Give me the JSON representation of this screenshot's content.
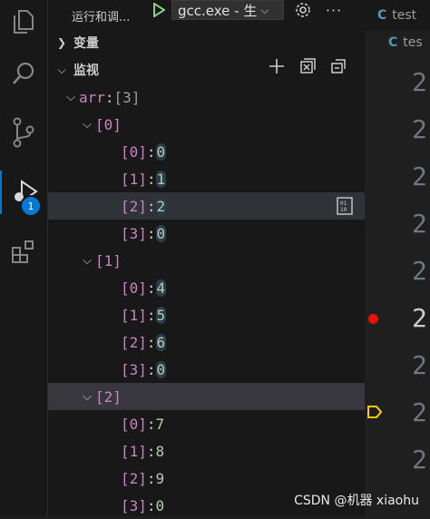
{
  "activity_bar": {
    "icons": [
      "files-icon",
      "search-icon",
      "source-control-icon",
      "run-debug-icon",
      "extensions-icon"
    ],
    "debug_badge": "1"
  },
  "sidebar": {
    "title": "运行和调...",
    "run_config": "gcc.exe - 生",
    "sections": {
      "variables": "变量",
      "watch": "监视"
    },
    "watch_rows": [
      {
        "indent": 0,
        "chev": "v",
        "name": "arr",
        "value": "[3]",
        "kind": "root"
      },
      {
        "indent": 1,
        "chev": "v",
        "name": "[0]",
        "value": "",
        "kind": "group"
      },
      {
        "indent": 2,
        "chev": "",
        "name": "[0]",
        "value": "0",
        "kind": "leaf"
      },
      {
        "indent": 2,
        "chev": "",
        "name": "[1]",
        "value": "1",
        "kind": "leaf"
      },
      {
        "indent": 2,
        "chev": "",
        "name": "[2]",
        "value": "2",
        "kind": "leaf"
      },
      {
        "indent": 2,
        "chev": "",
        "name": "[3]",
        "value": "0",
        "kind": "leaf"
      },
      {
        "indent": 1,
        "chev": "v",
        "name": "[1]",
        "value": "",
        "kind": "group"
      },
      {
        "indent": 2,
        "chev": "",
        "name": "[0]",
        "value": "4",
        "kind": "leaf"
      },
      {
        "indent": 2,
        "chev": "",
        "name": "[1]",
        "value": "5",
        "kind": "leaf"
      },
      {
        "indent": 2,
        "chev": "",
        "name": "[2]",
        "value": "6",
        "kind": "leaf"
      },
      {
        "indent": 2,
        "chev": "",
        "name": "[3]",
        "value": "0",
        "kind": "leaf"
      },
      {
        "indent": 1,
        "chev": "v",
        "name": "[2]",
        "value": "",
        "kind": "group"
      },
      {
        "indent": 2,
        "chev": "",
        "name": "[0]",
        "value": "7",
        "kind": "leaf"
      },
      {
        "indent": 2,
        "chev": "",
        "name": "[1]",
        "value": "8",
        "kind": "leaf"
      },
      {
        "indent": 2,
        "chev": "",
        "name": "[2]",
        "value": "9",
        "kind": "leaf"
      },
      {
        "indent": 2,
        "chev": "",
        "name": "[3]",
        "value": "0",
        "kind": "leaf"
      }
    ]
  },
  "editor": {
    "tab_label": "test",
    "breadcrumb": "tes",
    "line_digits": [
      "2",
      "2",
      "2",
      "2",
      "2",
      "2",
      "2",
      "2",
      "2"
    ]
  },
  "watermark": "CSDN @机器 xiaohu",
  "colors": {
    "name": "#c586c0",
    "value": "#b5cea8",
    "breakpoint": "#e51400",
    "badge": "#0078d4",
    "c_icon": "#519aba"
  }
}
